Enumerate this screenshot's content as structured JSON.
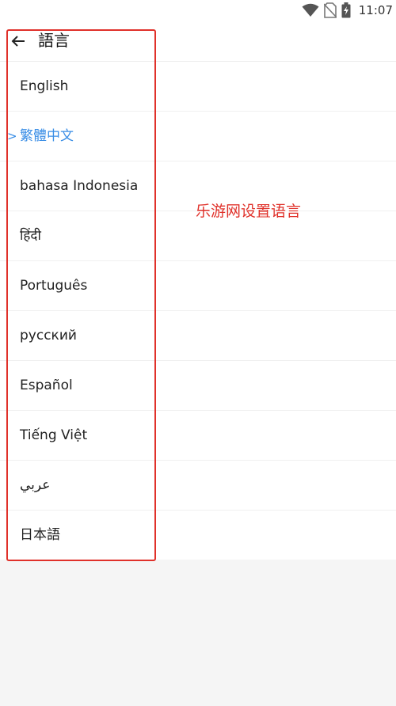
{
  "status_bar": {
    "time": "11:07",
    "icons": [
      "wifi-icon",
      "no-sim-icon",
      "battery-charging-icon"
    ]
  },
  "app_bar": {
    "title": "語言",
    "back_icon": "arrow-left-icon"
  },
  "languages": {
    "selected_marker": ">",
    "items": [
      {
        "label": "English"
      },
      {
        "label": "繁體中文",
        "selected": true
      },
      {
        "label": "bahasa Indonesia"
      },
      {
        "label": "हिंदी"
      },
      {
        "label": "Português"
      },
      {
        "label": "русский"
      },
      {
        "label": "Español"
      },
      {
        "label": "Tiếng Việt"
      },
      {
        "label": "عربي"
      },
      {
        "label": "日本語"
      }
    ]
  },
  "annotation": {
    "text": "乐游网设置语言",
    "color": "#e0312a"
  },
  "colors": {
    "accent": "#3a8ee6",
    "highlight": "#e0312a"
  }
}
